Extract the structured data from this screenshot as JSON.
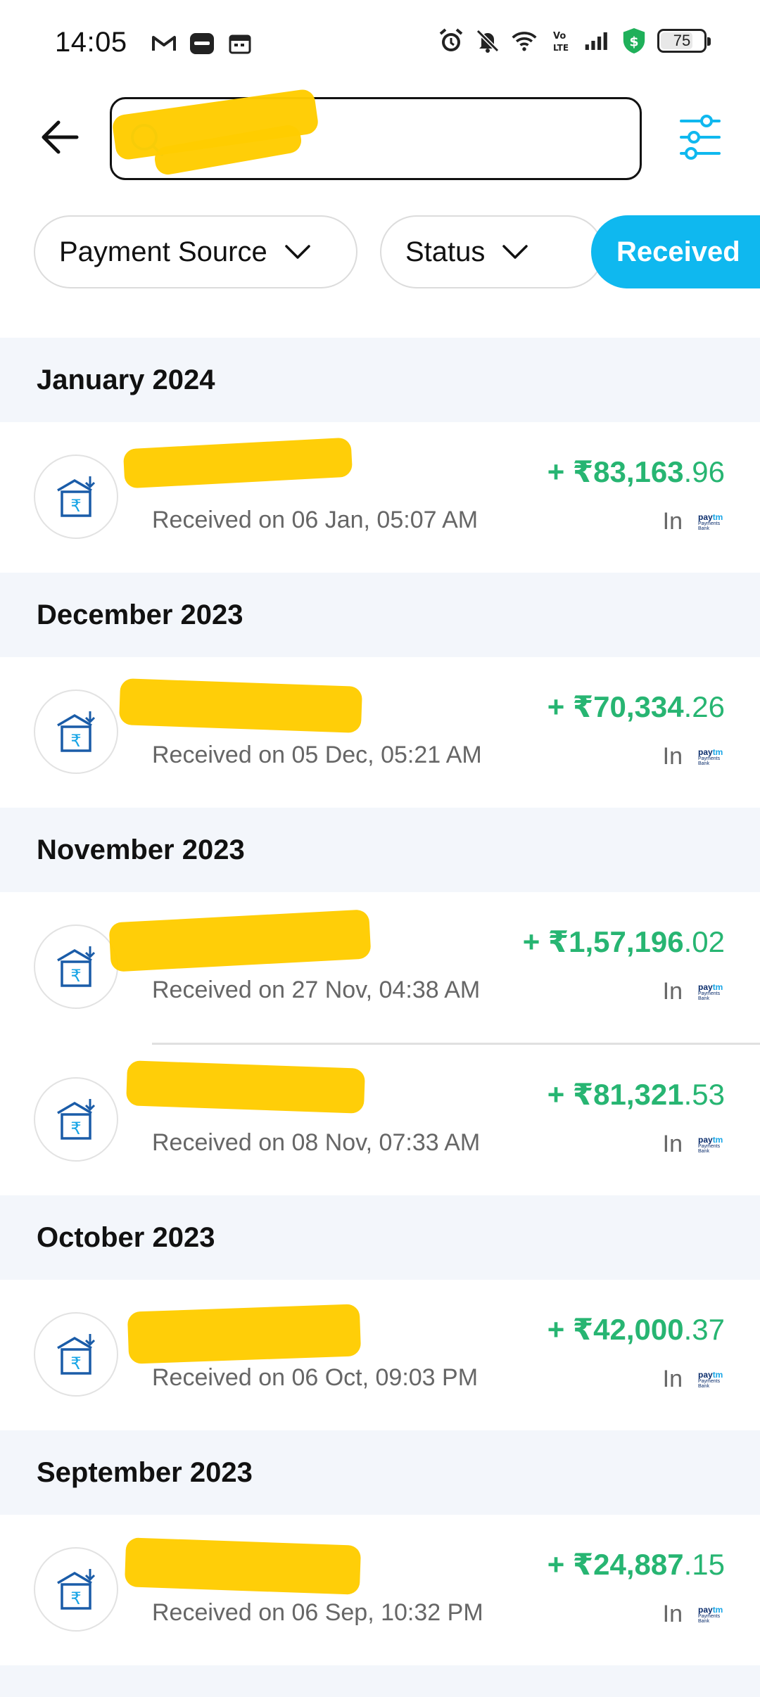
{
  "status_bar": {
    "time": "14:05",
    "battery": "75",
    "left_icons": [
      "gmail-icon",
      "paytm-app-icon",
      "calendar-icon"
    ],
    "right_icons": [
      "alarm-icon",
      "muted-bell-icon",
      "wifi-icon",
      "volte-icon",
      "signal-icon",
      "shield-dollar-icon"
    ]
  },
  "header": {
    "search_value": "",
    "search_placeholder": "",
    "back_icon": "back-arrow-icon",
    "filter_icon": "sliders-icon"
  },
  "chips": [
    {
      "label": "Payment Source",
      "active": false,
      "has_dropdown": true
    },
    {
      "label": "Status",
      "active": false,
      "has_dropdown": true
    },
    {
      "label": "Received",
      "active": true,
      "has_dropdown": false
    }
  ],
  "sections": [
    {
      "month": "January 2024",
      "transactions": [
        {
          "date": "Received on 06 Jan, 05:07 AM",
          "amount_main": "+ ₹83,163",
          "amount_dec": ".96",
          "in_label": "In"
        }
      ]
    },
    {
      "month": "December 2023",
      "transactions": [
        {
          "date": "Received on 05 Dec, 05:21 AM",
          "amount_main": "+ ₹70,334",
          "amount_dec": ".26",
          "in_label": "In"
        }
      ]
    },
    {
      "month": "November 2023",
      "transactions": [
        {
          "date": "Received on 27 Nov, 04:38 AM",
          "amount_main": "+ ₹1,57,196",
          "amount_dec": ".02",
          "in_label": "In"
        },
        {
          "date": "Received on 08 Nov, 07:33 AM",
          "amount_main": "+ ₹81,321",
          "amount_dec": ".53",
          "in_label": "In"
        }
      ]
    },
    {
      "month": "October 2023",
      "transactions": [
        {
          "date": "Received on 06 Oct, 09:03 PM",
          "amount_main": "+ ₹42,000",
          "amount_dec": ".37",
          "in_label": "In"
        }
      ]
    },
    {
      "month": "September 2023",
      "transactions": [
        {
          "date": "Received on 06 Sep, 10:32 PM",
          "amount_main": "+ ₹24,887",
          "amount_dec": ".15",
          "in_label": "In"
        }
      ]
    }
  ],
  "paytm_logo": {
    "text_1": "pay",
    "text_2": "tm",
    "subtext": "Payments Bank"
  },
  "colors": {
    "accent": "#0fb8ef",
    "amount_green": "#27b572",
    "section_bg": "#f3f6fb",
    "redaction": "#ffcc00"
  }
}
